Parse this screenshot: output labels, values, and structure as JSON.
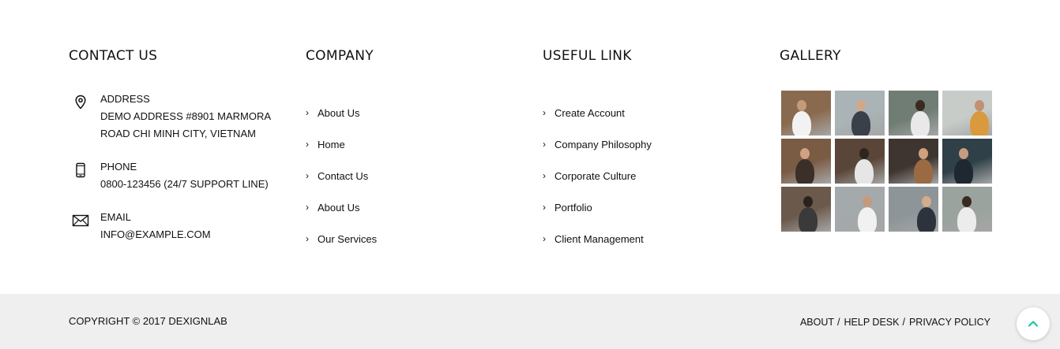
{
  "contact": {
    "heading": "CONTACT US",
    "address": {
      "label": "ADDRESS",
      "line1": "DEMO ADDRESS #8901 MARMORA",
      "line2": "ROAD CHI MINH CITY, VIETNAM",
      "icon": "map-pin-icon"
    },
    "phone": {
      "label": "PHONE",
      "value": "0800-123456 (24/7 SUPPORT LINE)",
      "icon": "mobile-phone-icon"
    },
    "email": {
      "label": "EMAIL",
      "value": "INFO@EXAMPLE.COM",
      "icon": "envelope-icon"
    }
  },
  "company": {
    "heading": "COMPANY",
    "links": [
      "About Us",
      "Home",
      "Contact Us",
      "About Us",
      "Our Services"
    ]
  },
  "useful": {
    "heading": "USEFUL LINK",
    "links": [
      "Create Account",
      "Company Philosophy",
      "Corporate Culture",
      "Portfolio",
      "Client Management"
    ]
  },
  "gallery": {
    "heading": "GALLERY",
    "thumbs": [
      {
        "bg": "#8a6a4e",
        "fig": "#f2f2f2",
        "head": "#c49a78"
      },
      {
        "bg": "#aab3b6",
        "fig": "#39404a",
        "head": "#d1a887"
      },
      {
        "bg": "#6f7d74",
        "fig": "#e9e9e9",
        "head": "#3a2a22"
      },
      {
        "bg": "#c7ccc9",
        "fig": "#d89a3c",
        "head": "#c29072"
      },
      {
        "bg": "#7a5b44",
        "fig": "#3b2f2a",
        "head": "#d2a183"
      },
      {
        "bg": "#5a4638",
        "fig": "#e6e6e6",
        "head": "#2d2520"
      },
      {
        "bg": "#3f3530",
        "fig": "#9a6a42",
        "head": "#d1a07e"
      },
      {
        "bg": "#2f4048",
        "fig": "#1f2730",
        "head": "#c89c7f"
      },
      {
        "bg": "#6b5a4c",
        "fig": "#3a3a3a",
        "head": "#2b221d"
      },
      {
        "bg": "#a4a9ab",
        "fig": "#f1f1f1",
        "head": "#c59a7c"
      },
      {
        "bg": "#8e9598",
        "fig": "#2c333c",
        "head": "#d5ab8c"
      },
      {
        "bg": "#9aa39e",
        "fig": "#ececec",
        "head": "#3a2a22"
      }
    ]
  },
  "bottom": {
    "copyright": "COPYRIGHT © 2017 DEXIGNLAB",
    "links": [
      "ABOUT",
      "HELP DESK",
      "PRIVACY POLICY"
    ],
    "separator": "/"
  },
  "scroll_top": {
    "icon": "chevron-up-icon",
    "color": "#1ec6a3"
  },
  "colors": {
    "footer_bottom_bg": "#efefef",
    "text": "#111111",
    "accent": "#1ec6a3"
  }
}
